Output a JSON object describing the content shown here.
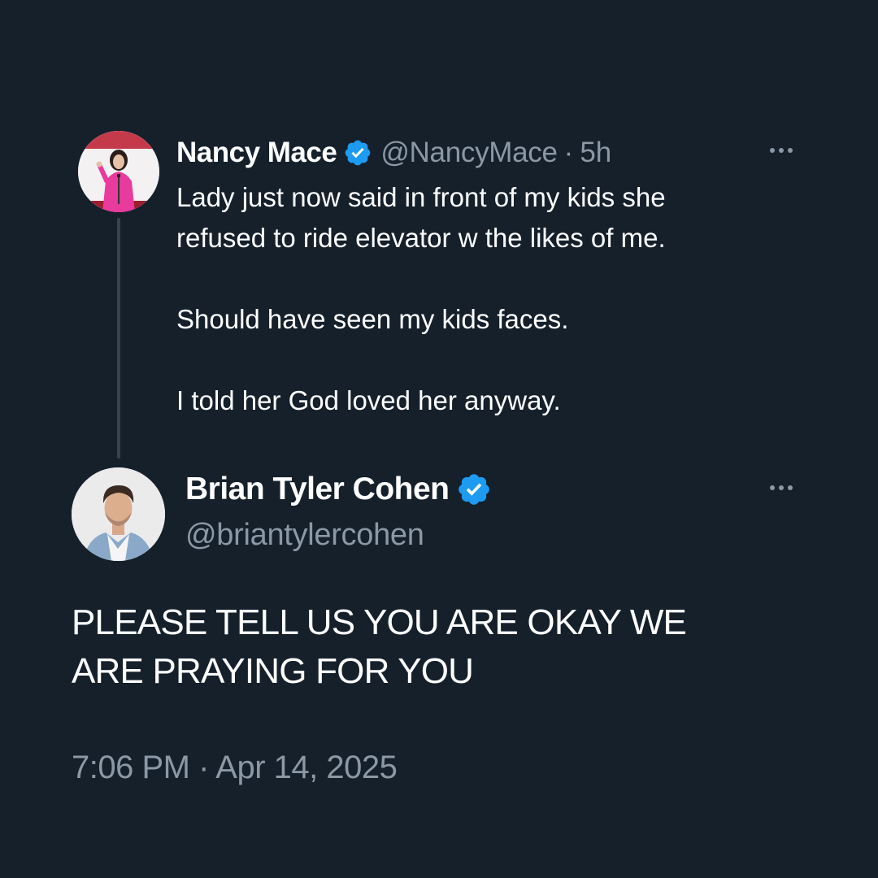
{
  "colors": {
    "background": "#15202b",
    "text_primary": "#ffffff",
    "text_secondary": "#8b98a5",
    "verified_badge": "#1d9bf0",
    "thread_line": "#38444d"
  },
  "parent_tweet": {
    "display_name": "Nancy Mace",
    "verified_icon": "verified-badge-icon",
    "handle": "@NancyMace",
    "separator": "·",
    "time": "5h",
    "more_icon": "more-options-icon",
    "text_lines": [
      "Lady just now said in front of my kids she",
      "refused to ride elevator w the likes of me.",
      "Should have seen my kids faces.",
      "I told her God loved her anyway."
    ]
  },
  "reply_tweet": {
    "display_name": "Brian Tyler Cohen",
    "verified_icon": "verified-badge-icon",
    "handle": "@briantylercohen",
    "more_icon": "more-options-icon",
    "text_lines": [
      "PLEASE TELL US YOU ARE OKAY WE",
      "ARE PRAYING FOR YOU"
    ],
    "timestamp": "7:06 PM · Apr 14, 2025"
  }
}
